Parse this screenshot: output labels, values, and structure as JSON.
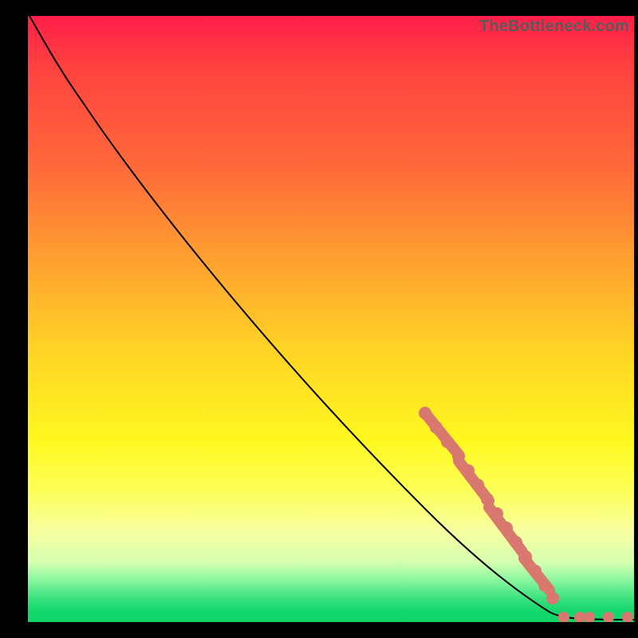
{
  "attribution": "TheBottleneck.com",
  "colors": {
    "dot": "#d9786e",
    "curve": "#000000"
  },
  "chart_data": {
    "type": "line",
    "title": "",
    "xlabel": "",
    "ylabel": "",
    "xlim": [
      0,
      100
    ],
    "ylim": [
      0,
      100
    ],
    "note": "Axes are unlabeled in the image; values below are estimated from pixel positions on a 0–100 scale for both axes.",
    "series": [
      {
        "name": "curve",
        "x": [
          0,
          4,
          8,
          12,
          18,
          26,
          34,
          42,
          50,
          58,
          64,
          68,
          72,
          76,
          80,
          84,
          88,
          92,
          96,
          100
        ],
        "y": [
          100,
          98,
          96,
          93,
          88,
          80,
          72,
          64,
          56,
          48,
          42,
          37,
          32,
          26,
          20,
          14,
          8,
          3,
          0.5,
          0.5
        ]
      }
    ],
    "highlighted_segments": [
      {
        "x_start": 64,
        "x_end": 70,
        "comment": "dense salmon dots along curve"
      },
      {
        "x_start": 70,
        "x_end": 76,
        "comment": "dense salmon dots along curve"
      },
      {
        "x_start": 76,
        "x_end": 84,
        "comment": "dense salmon dots along curve"
      },
      {
        "x_start": 84,
        "x_end": 90,
        "comment": "sparser salmon dots tapering"
      }
    ],
    "bottom_dots_x": [
      88,
      91,
      94,
      96,
      99
    ],
    "bottom_dots_y": 0.5
  }
}
